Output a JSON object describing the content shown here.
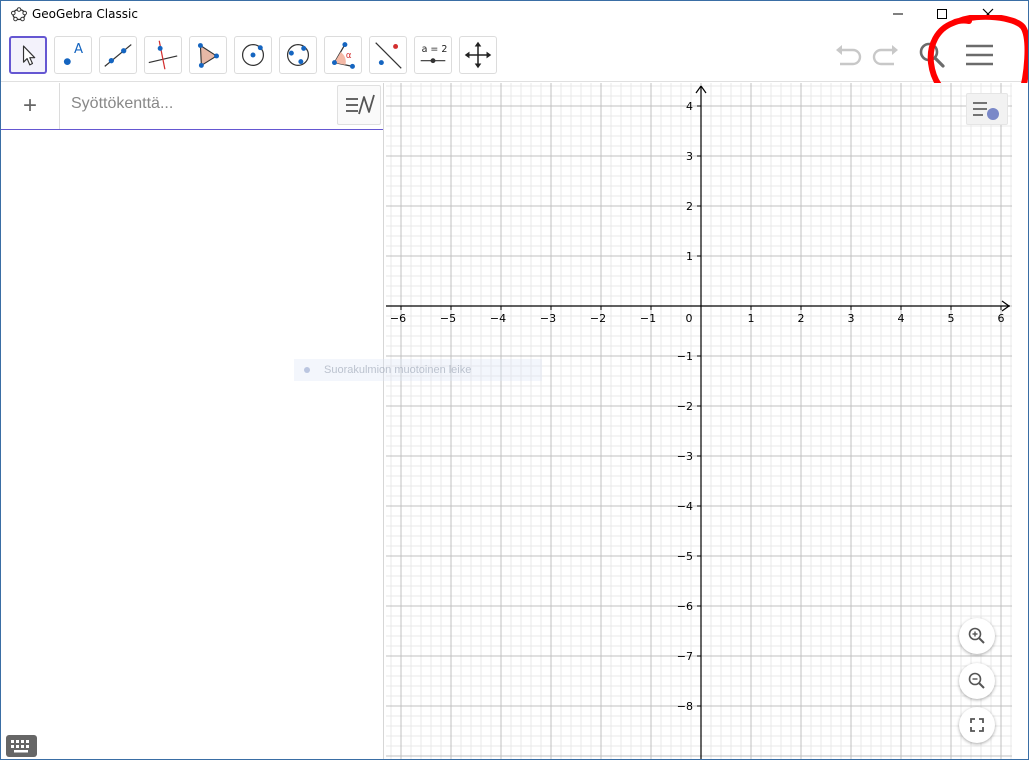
{
  "window": {
    "title": "GeoGebra Classic",
    "controls": [
      "minimize",
      "maximize",
      "close"
    ]
  },
  "toolbar": {
    "tools": [
      {
        "name": "move-tool",
        "icon": "arrow-pointer-icon",
        "selected": true
      },
      {
        "name": "point-tool",
        "icon": "point-icon",
        "label": "A"
      },
      {
        "name": "line-tool",
        "icon": "line-through-points-icon"
      },
      {
        "name": "perpendicular-line-tool",
        "icon": "perpendicular-line-icon"
      },
      {
        "name": "polygon-tool",
        "icon": "polygon-icon"
      },
      {
        "name": "circle-center-point-tool",
        "icon": "circle-center-point-icon"
      },
      {
        "name": "circle-three-points-tool",
        "icon": "circle-three-points-icon"
      },
      {
        "name": "angle-tool",
        "icon": "angle-icon",
        "label": "α"
      },
      {
        "name": "reflect-tool",
        "icon": "reflect-about-line-icon"
      },
      {
        "name": "slider-tool",
        "icon": "slider-icon",
        "label": "a = 2"
      },
      {
        "name": "move-graphics-view-tool",
        "icon": "move-arrows-icon"
      }
    ],
    "right_buttons": [
      {
        "name": "undo",
        "icon": "undo-icon"
      },
      {
        "name": "redo",
        "icon": "redo-icon"
      },
      {
        "name": "search",
        "icon": "search-icon"
      },
      {
        "name": "main-menu",
        "icon": "hamburger-menu-icon"
      }
    ],
    "annotation_color": "#ff0000"
  },
  "algebra": {
    "add_symbol": "+",
    "input_placeholder": "Syöttökenttä..."
  },
  "graphics": {
    "x_range": [
      -6,
      6
    ],
    "y_range": [
      -8,
      4
    ],
    "x_ticks": [
      "−6",
      "−5",
      "−4",
      "−3",
      "−2",
      "−1",
      "0",
      "1",
      "2",
      "3",
      "4",
      "5",
      "6"
    ],
    "y_ticks": [
      "4",
      "3",
      "2",
      "1",
      "−1",
      "−2",
      "−3",
      "−4",
      "−5",
      "−6",
      "−7",
      "−8"
    ],
    "grid": true,
    "tooltip_text": "Suorakulmion muotoinen leike",
    "zoom_buttons": [
      "zoom-in-icon",
      "zoom-out-icon",
      "fullscreen-icon"
    ]
  },
  "colors": {
    "accent": "#6557d2",
    "point_blue": "#1565c0",
    "axis": "#000000",
    "grid_major": "#c0c0c0",
    "grid_minor": "#e8e8e8"
  }
}
